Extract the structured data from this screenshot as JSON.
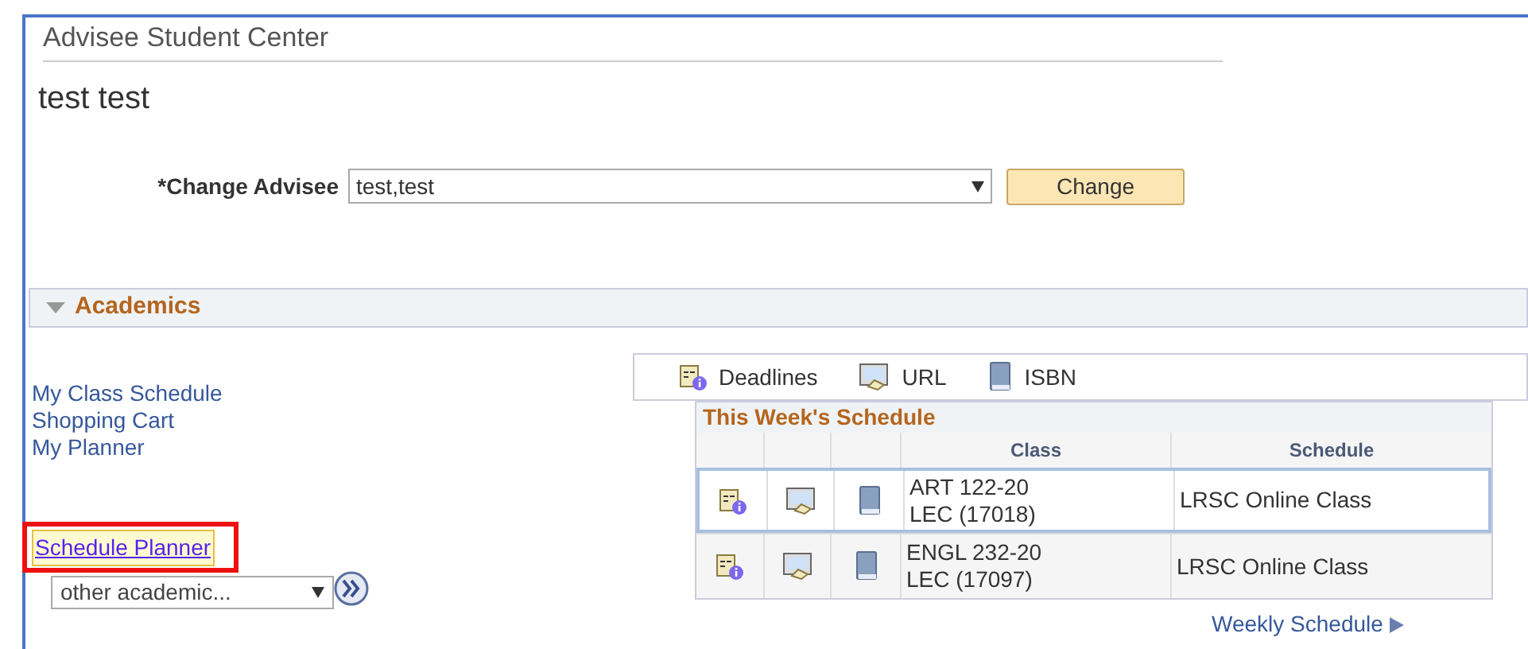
{
  "page": {
    "title": "Advisee Student Center",
    "student_name": "test test"
  },
  "change_advisee": {
    "label": "*Change Advisee",
    "value": "test,test",
    "button": "Change"
  },
  "academics": {
    "title": "Academics",
    "expanded": true,
    "links": [
      "My Class Schedule",
      "Shopping Cart",
      "My Planner"
    ],
    "planner_link": {
      "label": "Schedule Planner",
      "highlighted": true
    },
    "other_select": {
      "value": "other academic..."
    },
    "legend": [
      {
        "kind": "deadlines",
        "label": "Deadlines"
      },
      {
        "kind": "url",
        "label": "URL"
      },
      {
        "kind": "isbn",
        "label": "ISBN"
      }
    ],
    "schedule": {
      "title": "This Week's Schedule",
      "columns": [
        "Class",
        "Schedule"
      ],
      "rows": [
        {
          "class_lines": [
            "ART 122-20",
            "LEC (17018)"
          ],
          "schedule": "LRSC Online Class",
          "selected": true
        },
        {
          "class_lines": [
            "ENGL 232-20",
            "LEC (17097)"
          ],
          "schedule": "LRSC Online Class",
          "selected": false
        }
      ]
    },
    "weekly_link": "Weekly Schedule"
  }
}
